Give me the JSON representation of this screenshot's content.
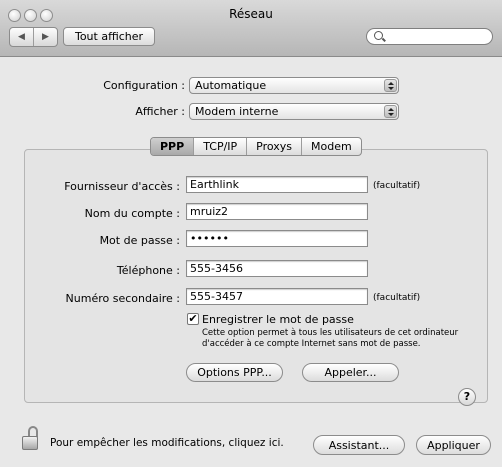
{
  "window": {
    "title": "Réseau"
  },
  "toolbar": {
    "show_all_label": "Tout afficher",
    "back_glyph": "◀",
    "forward_glyph": "▶",
    "search_placeholder": ""
  },
  "config": {
    "label": "Configuration :",
    "value": "Automatique"
  },
  "show": {
    "label": "Afficher :",
    "value": "Modem interne"
  },
  "tabs": [
    {
      "label": "PPP",
      "selected": true
    },
    {
      "label": "TCP/IP",
      "selected": false
    },
    {
      "label": "Proxys",
      "selected": false
    },
    {
      "label": "Modem",
      "selected": false
    }
  ],
  "form": {
    "provider": {
      "label": "Fournisseur d'accès :",
      "value": "Earthlink",
      "hint": "(facultatif)"
    },
    "account": {
      "label": "Nom du compte :",
      "value": "mruiz2"
    },
    "password": {
      "label": "Mot de passe :",
      "value": "••••••"
    },
    "phone": {
      "label": "Téléphone :",
      "value": "555-3456"
    },
    "alt_phone": {
      "label": "Numéro secondaire :",
      "value": "555-3457",
      "hint": "(facultatif)"
    }
  },
  "save_password": {
    "checked": true,
    "check_glyph": "✔",
    "label": "Enregistrer le mot de passe",
    "description": "Cette option permet à tous les utilisateurs de cet ordinateur d'accéder à ce compte Internet sans mot de passe."
  },
  "buttons": {
    "ppp_options": "Options PPP...",
    "call": "Appeler...",
    "help": "?",
    "assistant": "Assistant...",
    "apply": "Appliquer"
  },
  "footer": {
    "lock_text": "Pour empêcher les modifications, cliquez ici."
  },
  "icons": [
    "close-traffic-light-icon",
    "minimize-traffic-light-icon",
    "zoom-traffic-light-icon",
    "back-arrow-icon",
    "forward-arrow-icon",
    "search-icon",
    "popup-arrows-icon",
    "checkmark-icon",
    "help-icon",
    "lock-icon"
  ]
}
